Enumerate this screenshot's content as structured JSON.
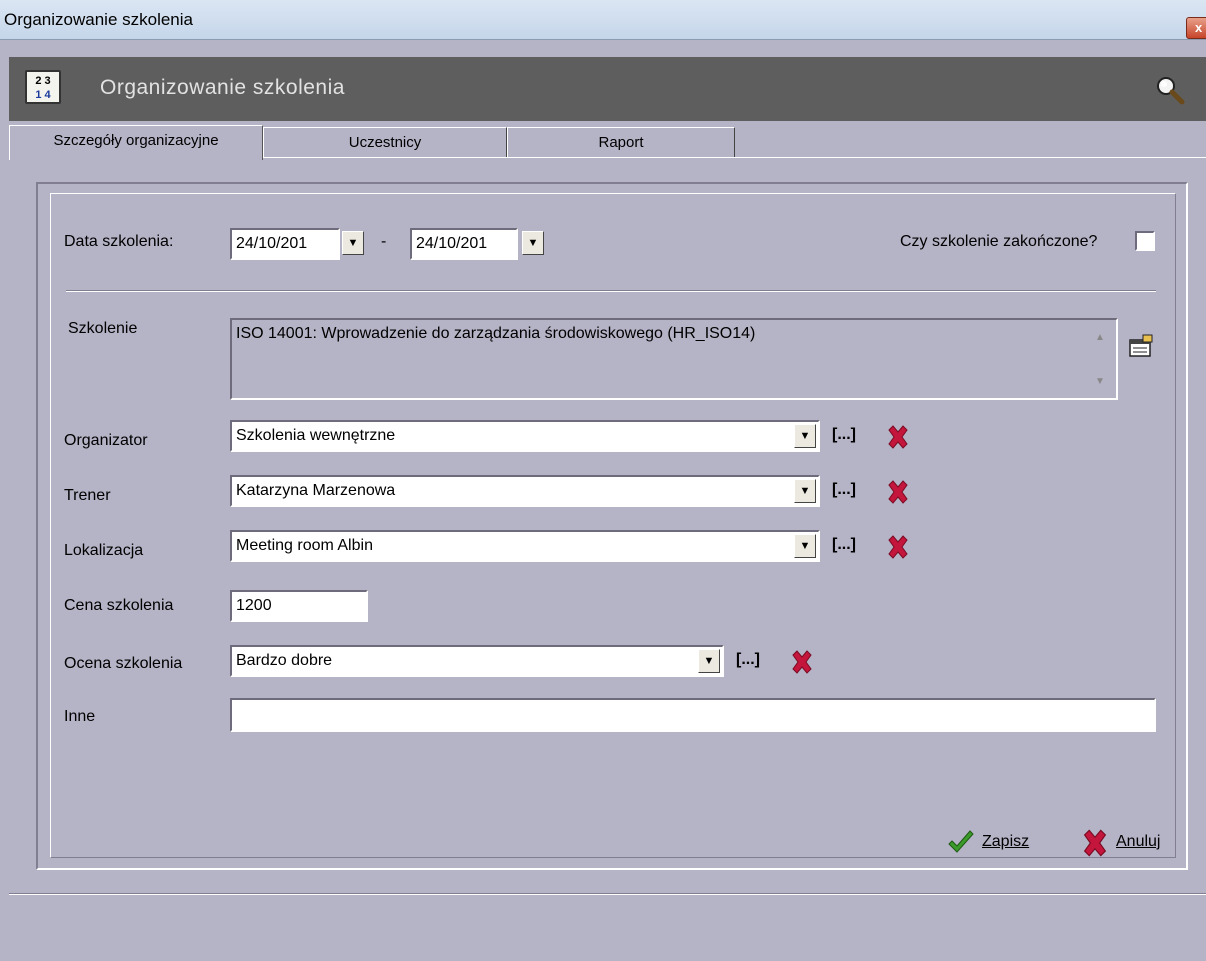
{
  "window": {
    "title": "Organizowanie szkolenia"
  },
  "header": {
    "title": "Organizowanie szkolenia",
    "app_icon_text_1": "2 3",
    "app_icon_text_2": "1 4"
  },
  "tabs": [
    {
      "label": "Szczegóły organizacyjne",
      "active": true
    },
    {
      "label": "Uczestnicy",
      "active": false
    },
    {
      "label": "Raport",
      "active": false
    }
  ],
  "form": {
    "data_szkolenia": {
      "label": "Data szkolenia:",
      "from": "24/10/201",
      "separator": "-",
      "to": "24/10/201"
    },
    "zakonczone": {
      "label": "Czy szkolenie zakończone?",
      "checked": false
    },
    "szkolenie": {
      "label": "Szkolenie",
      "value": "ISO 14001: Wprowadzenie do zarządzania środowiskowego (HR_ISO14)"
    },
    "organizator": {
      "label": "Organizator",
      "value": "Szkolenia wewnętrzne",
      "more": "[...]"
    },
    "trener": {
      "label": "Trener",
      "value": "Katarzyna Marzenowa",
      "more": "[...]"
    },
    "lokalizacja": {
      "label": "Lokalizacja",
      "value": "Meeting room Albin",
      "more": "[...]"
    },
    "cena": {
      "label": "Cena szkolenia",
      "value": "1200"
    },
    "ocena": {
      "label": "Ocena szkolenia",
      "value": "Bardzo dobre",
      "more": "[...]"
    },
    "inne": {
      "label": "Inne",
      "value": ""
    }
  },
  "footer": {
    "save_label": "Zapisz",
    "cancel_label": "Anuluj"
  },
  "colors": {
    "accent_red": "#c4163c",
    "check_green": "#3a9a2a",
    "header_bg": "#5e5e5e",
    "panel_bg": "#b5b3c6"
  }
}
